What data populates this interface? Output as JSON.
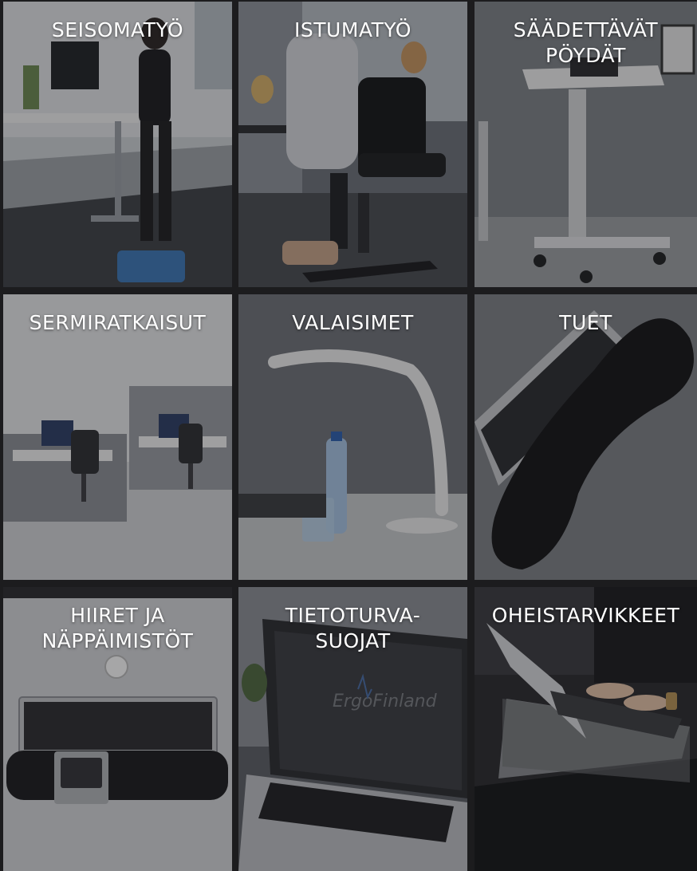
{
  "tiles": [
    {
      "label": "SEISOMATYÖ",
      "image": "standing-desk-photo"
    },
    {
      "label": "ISTUMATYÖ",
      "image": "office-chair-photo"
    },
    {
      "label": "SÄÄDETTÄVÄT\nPÖYDÄT",
      "image": "adjustable-table-photo"
    },
    {
      "label": "SERMIRATKAISUT",
      "image": "office-partition-photo"
    },
    {
      "label": "VALAISIMET",
      "image": "desk-lamp-photo"
    },
    {
      "label": "TUET",
      "image": "wrist-rest-photo"
    },
    {
      "label": "HIIRET JA\nNÄPPÄIMISTÖT",
      "image": "keyboard-mouse-photo"
    },
    {
      "label": "TIETOTURVA-\nSUOJAT",
      "image": "privacy-screen-photo"
    },
    {
      "label": "OHEISTARVIKKEET",
      "image": "laptop-accessory-photo"
    }
  ],
  "privacy_filter_logo": "ErgoFinland",
  "colors": {
    "background": "#1c1c1e",
    "label_text": "#ffffff",
    "overlay": "rgba(20,20,24,0.38)"
  }
}
